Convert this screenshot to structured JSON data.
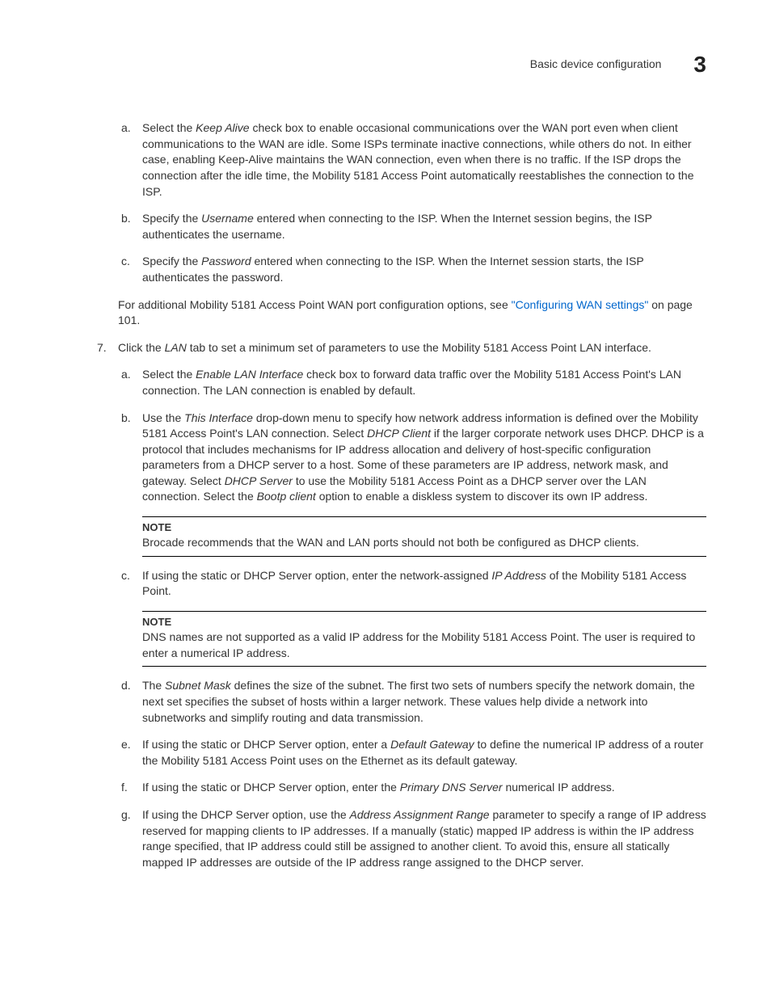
{
  "header": {
    "title": "Basic device configuration",
    "chapter": "3"
  },
  "items": {
    "a1_pre": "Select the ",
    "a1_i": "Keep Alive",
    "a1_post": " check box to enable occasional communications over the WAN port even when client communications to the WAN are idle. Some ISPs terminate inactive connections, while others do not. In either case, enabling Keep-Alive maintains the WAN connection, even when there is no traffic. If the ISP drops the connection after the idle time, the Mobility 5181 Access Point automatically reestablishes the connection to the ISP.",
    "b1_pre": "Specify the ",
    "b1_i": "Username",
    "b1_post": " entered when connecting to the ISP. When the Internet session begins, the ISP authenticates the username.",
    "c1_pre": "Specify the ",
    "c1_i": "Password",
    "c1_post": " entered when connecting to the ISP. When the Internet session starts, the ISP authenticates the password.",
    "para1_pre": "For additional Mobility 5181 Access Point WAN port configuration options, see ",
    "para1_link": "\"Configuring WAN settings\"",
    "para1_post": " on page 101.",
    "step7_pre": "Click the ",
    "step7_i": "LAN",
    "step7_post": " tab to set a minimum set of parameters to use the Mobility 5181 Access Point LAN interface.",
    "a2_pre": "Select the ",
    "a2_i": "Enable LAN Interface",
    "a2_post": " check box to forward data traffic over the Mobility 5181 Access Point's LAN connection. The LAN connection is enabled by default.",
    "b2_pre": "Use the ",
    "b2_i1": "This Interface",
    "b2_mid1": " drop-down menu to specify how network address information is defined over the Mobility 5181 Access Point's LAN connection. Select ",
    "b2_i2": "DHCP Client",
    "b2_mid2": " if the larger corporate network uses DHCP. DHCP is a protocol that includes mechanisms for IP address allocation and delivery of host-specific configuration parameters from a DHCP server to a host. Some of these parameters are IP address, network mask, and gateway. Select ",
    "b2_i3": "DHCP Server",
    "b2_mid3": " to use the Mobility 5181 Access Point as a DHCP server over the LAN connection. Select the ",
    "b2_i4": "Bootp client",
    "b2_post": " option to enable a diskless system to discover its own IP address.",
    "note1_label": "NOTE",
    "note1_text": "Brocade recommends that the WAN and LAN ports should not both be configured as DHCP clients.",
    "c2_pre": "If using the static or DHCP Server option, enter the network-assigned ",
    "c2_i": "IP Address",
    "c2_post": " of the Mobility 5181 Access Point.",
    "note2_label": "NOTE",
    "note2_text": "DNS names are not supported as a valid IP address for the Mobility 5181 Access Point. The user is required to enter a numerical IP address.",
    "d2_pre": "The ",
    "d2_i": "Subnet Mask",
    "d2_post": " defines the size of the subnet. The first two sets of numbers specify the network domain, the next set specifies the subset of hosts within a larger network. These values help divide a network into subnetworks and simplify routing and data transmission.",
    "e2_pre": "If using the static or DHCP Server option, enter a ",
    "e2_i": "Default Gateway",
    "e2_post": " to define the numerical IP address of a router the Mobility 5181 Access Point uses on the Ethernet as its default gateway.",
    "f2_pre": "If using the static or DHCP Server option, enter the ",
    "f2_i": "Primary DNS Server",
    "f2_post": " numerical IP address.",
    "g2_pre": "If using the DHCP Server option, use the ",
    "g2_i": "Address Assignment Range",
    "g2_post": " parameter to specify a range of IP address reserved for mapping clients to IP addresses. If a manually (static) mapped IP address is within the IP address range specified, that IP address could still be assigned to another client. To avoid this, ensure all statically mapped IP addresses are outside of the IP address range assigned to the DHCP server."
  },
  "markers": {
    "a": "a.",
    "b": "b.",
    "c": "c.",
    "d": "d.",
    "e": "e.",
    "f": "f.",
    "g": "g.",
    "seven": "7."
  }
}
